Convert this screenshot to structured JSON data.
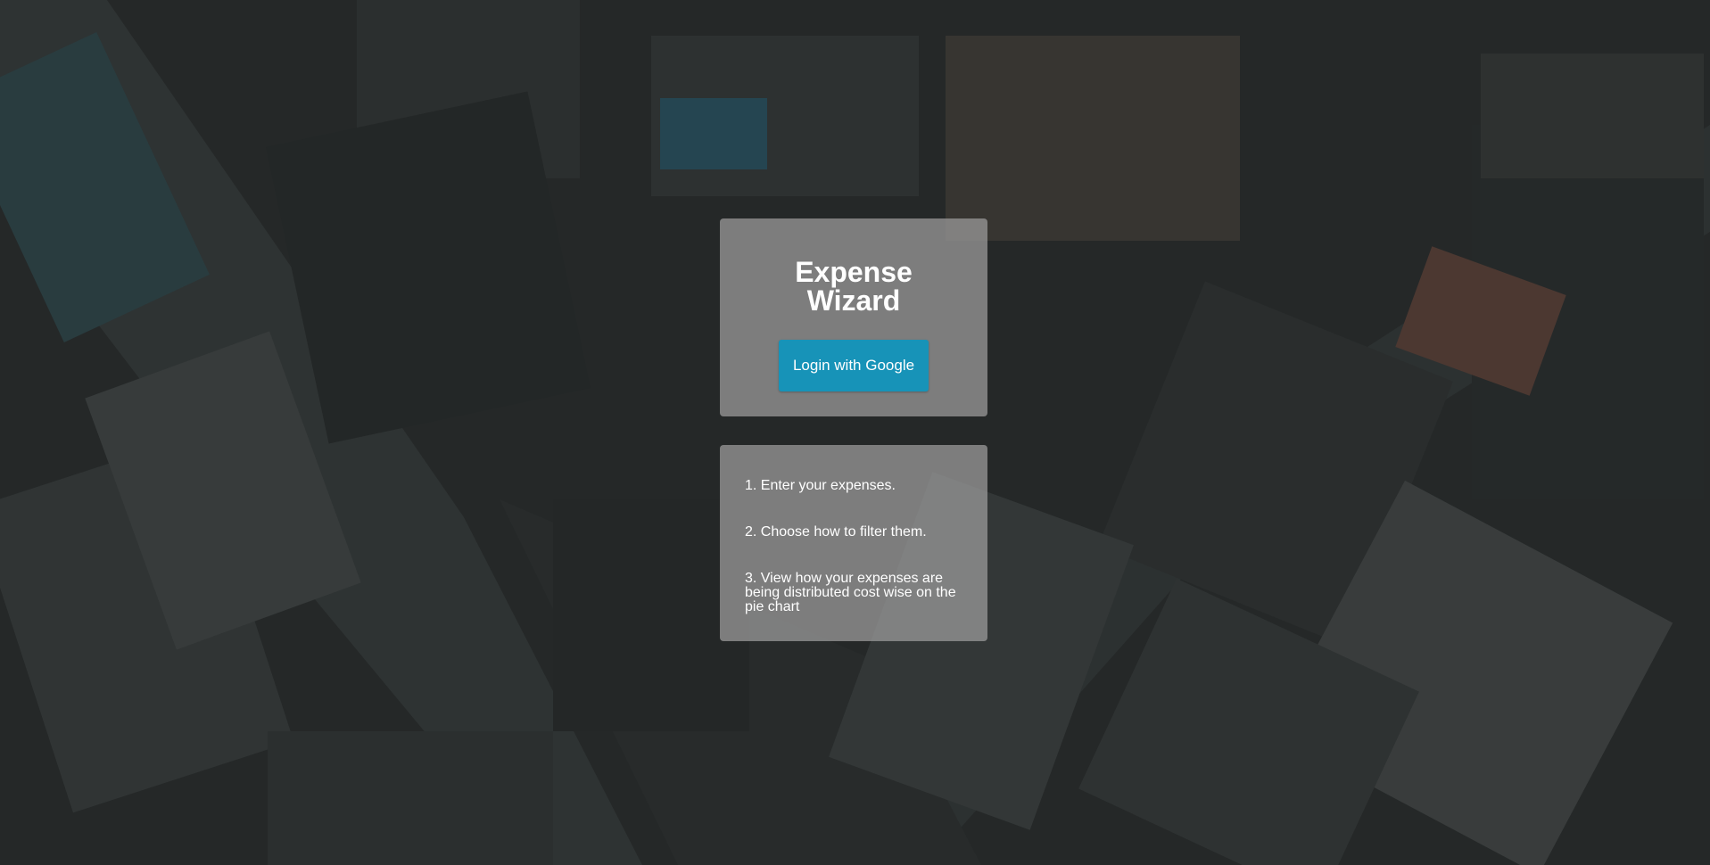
{
  "app": {
    "title_line1": "Expense",
    "title_line2": "Wizard"
  },
  "login": {
    "button_label": "Login with Google",
    "button_color": "#1793b8"
  },
  "steps": [
    "1. Enter your expenses.",
    "2. Choose how to filter them.",
    "3. View how your expenses are being distributed cost wise on the pie chart"
  ],
  "background": {
    "description_icon": "city-aerial-photo"
  }
}
